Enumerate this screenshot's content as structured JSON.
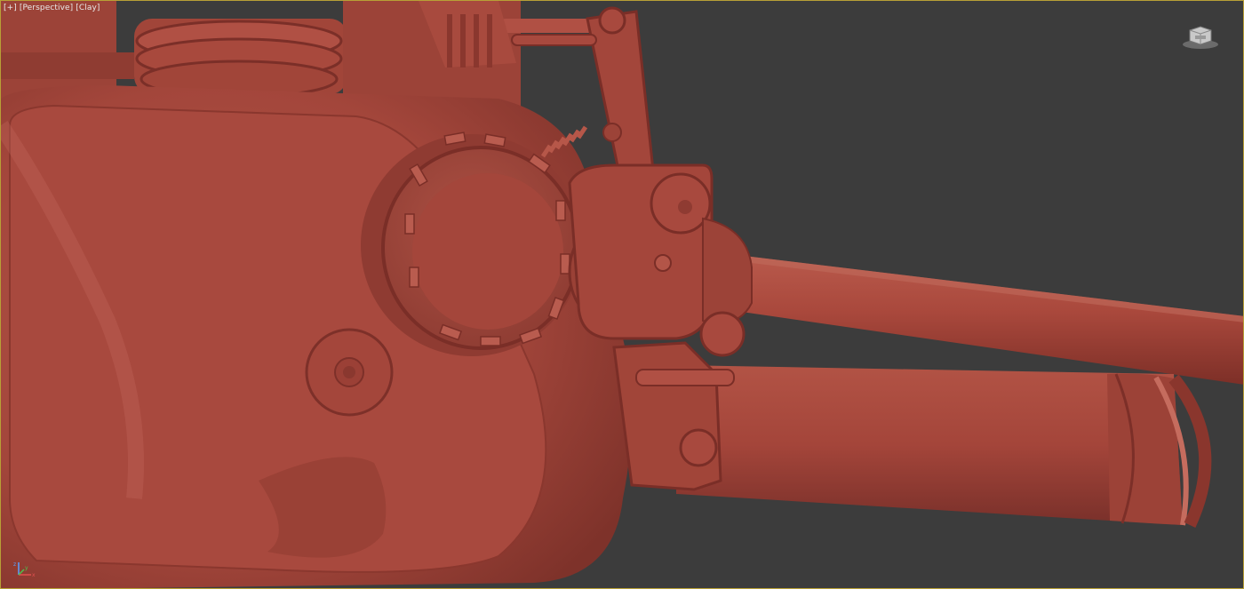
{
  "viewport": {
    "label_parts": [
      "[+]",
      "[Perspective]",
      "[Clay]"
    ],
    "border_color": "#b8a036",
    "background_color": "#3c3c3c"
  },
  "scene": {
    "description_hidden": "",
    "material": "clay",
    "clay_color": "#a7483c"
  },
  "viewcube": {
    "icon": "viewcube-icon"
  },
  "axis": {
    "x": "x",
    "y": "y",
    "z": "z"
  }
}
